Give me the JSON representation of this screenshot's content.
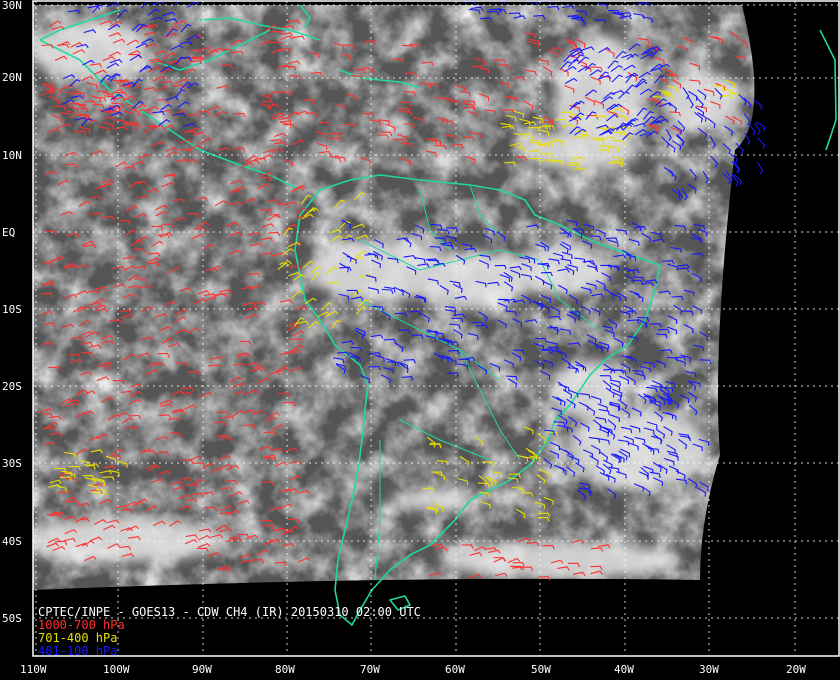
{
  "title": "CPTEC/INPE - GOES13 - CDW CH4 (IR) 20150310 02:00 UTC",
  "legend": [
    {
      "label": "1000-700 hPa",
      "color": "#ff3030"
    },
    {
      "label": "701-400 hPa",
      "color": "#e8e000"
    },
    {
      "label": "401-100 hPa",
      "color": "#1818ff"
    }
  ],
  "lat_labels": [
    "30N",
    "20N",
    "10N",
    "EQ",
    "10S",
    "20S",
    "30S",
    "40S",
    "50S"
  ],
  "lon_labels": [
    "110W",
    "100W",
    "90W",
    "80W",
    "70W",
    "60W",
    "50W",
    "40W",
    "30W",
    "20W"
  ],
  "colors": {
    "coastline": "#20d8a0",
    "grid": "#ffffff",
    "background": "#000000",
    "cloud_base": "#5a5a5a"
  }
}
